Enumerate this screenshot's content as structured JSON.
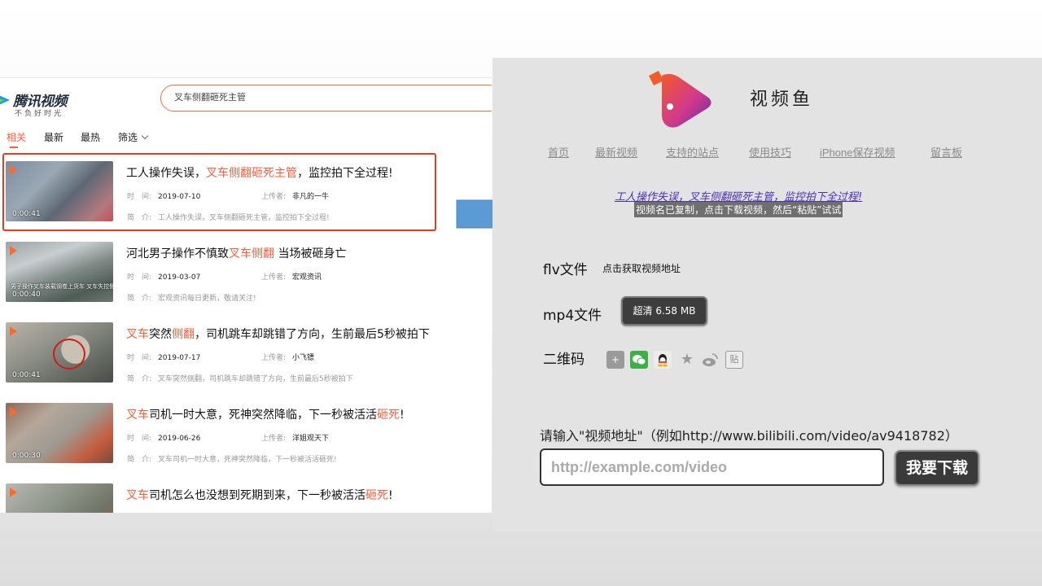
{
  "left": {
    "logo": {
      "name": "腾讯视频",
      "slogan": "不负好时光"
    },
    "search": {
      "value": "叉车侧翻砸死主管"
    },
    "tabs": [
      {
        "label": "相关"
      },
      {
        "label": "最新"
      },
      {
        "label": "最热"
      },
      {
        "label": "筛选"
      }
    ],
    "meta_labels": {
      "time": "时　间:",
      "uploader": "上传者:",
      "intro": "简　介:"
    },
    "results": [
      {
        "title_parts": [
          "工人操作失误，",
          "叉车侧翻砸死主管",
          "，监控拍下全过程!"
        ],
        "date": "2019-07-10",
        "uploader": "非凡的一牛",
        "desc": "工人操作失误，叉车侧翻砸死主管，监控拍下全过程!",
        "duration": "0:00:41",
        "caption": ""
      },
      {
        "title_parts": [
          "河北男子操作不慎致",
          "叉车侧翻",
          " 当场被砸身亡"
        ],
        "date": "2019-03-07",
        "uploader": "宏观资讯",
        "desc": "宏观资讯每日更新，敬请关注!",
        "duration": "0:00:40",
        "caption": "男子操作叉车装载钢卷上货车 叉车失控侧翻"
      },
      {
        "title_parts": [
          "叉车",
          "突然",
          "侧翻",
          "，司机跳车却跳错了方向，生前最后5秒被拍下"
        ],
        "date": "2019-07-17",
        "uploader": "小飞镖",
        "desc": "叉车突然侧翻，司机跳车却跳错了方向，生前最后5秒被拍下",
        "duration": "0:00:41",
        "caption": ""
      },
      {
        "title_parts": [
          "叉车",
          "司机一时大意，死神突然降临，下一秒被活活",
          "砸死",
          "!"
        ],
        "date": "2019-06-26",
        "uploader": "洋姐观天下",
        "desc": "叉车司机一时大意，死神突然降临，下一秒被活活砸死!",
        "duration": "0:00:30",
        "caption": ""
      },
      {
        "title_parts": [
          "叉车",
          "司机怎么也没想到死期到来，下一秒被活活",
          "砸死",
          "!"
        ],
        "date": "",
        "uploader": "",
        "desc": "",
        "duration": "",
        "caption": ""
      }
    ]
  },
  "right": {
    "site_name": "视频鱼",
    "nav": [
      "首页",
      "最新视频",
      "支持的站点",
      "使用技巧",
      "iPhone保存视频",
      "留言板"
    ],
    "video_title": "工人操作失误，叉车侧翻砸死主管，监控拍下全过程!",
    "copied_note": "视频名已复制，点击下载视频，然后“粘贴”试试",
    "flv": {
      "label": "flv文件",
      "action": "点击获取视频地址"
    },
    "mp4": {
      "label": "mp4文件",
      "button": "超清 6.58 MB"
    },
    "qrcode": {
      "label": "二维码"
    },
    "share_icons": [
      "plus-icon",
      "wechat-icon",
      "qq-icon",
      "star-icon",
      "weibo-icon",
      "tieba-icon"
    ],
    "input_label": "请输入\"视频地址\"（例如http://www.bilibili.com/video/av9418782）",
    "input_placeholder": "http://example.com/video",
    "download_button": "我要下载"
  },
  "colors": {
    "keyword": "#ff5c38",
    "highlight_border": "#e53b1f",
    "arrow": "#5b9bd5",
    "right_bg": "#e3e3e3",
    "link": "#4b2fbf"
  }
}
